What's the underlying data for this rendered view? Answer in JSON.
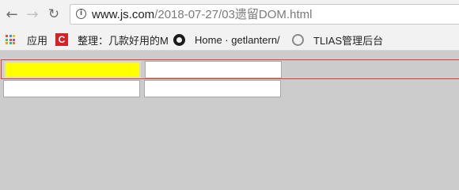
{
  "browser": {
    "url_host": "www.js.com",
    "url_path": "/2018-07-27/03遗留DOM.html",
    "apps_colors": [
      "#e74c3c",
      "#3498db",
      "#f1c40f",
      "#2ecc71",
      "#e74c3c",
      "#9b59b6",
      "#f39c12",
      "#1abc9c",
      "#e67e22"
    ]
  },
  "bookmarks": [
    {
      "label": "应用",
      "icon": "apps-icon"
    },
    {
      "label": "整理：几款好用的M",
      "icon": "cc-icon"
    },
    {
      "label": "Home · getlantern/",
      "icon": "github-icon"
    },
    {
      "label": "TLIAS管理后台",
      "icon": "globe-icon"
    }
  ],
  "page": {
    "fields": [
      {
        "value": "",
        "highlighted": true
      },
      {
        "value": ""
      },
      {
        "value": ""
      },
      {
        "value": ""
      }
    ]
  }
}
